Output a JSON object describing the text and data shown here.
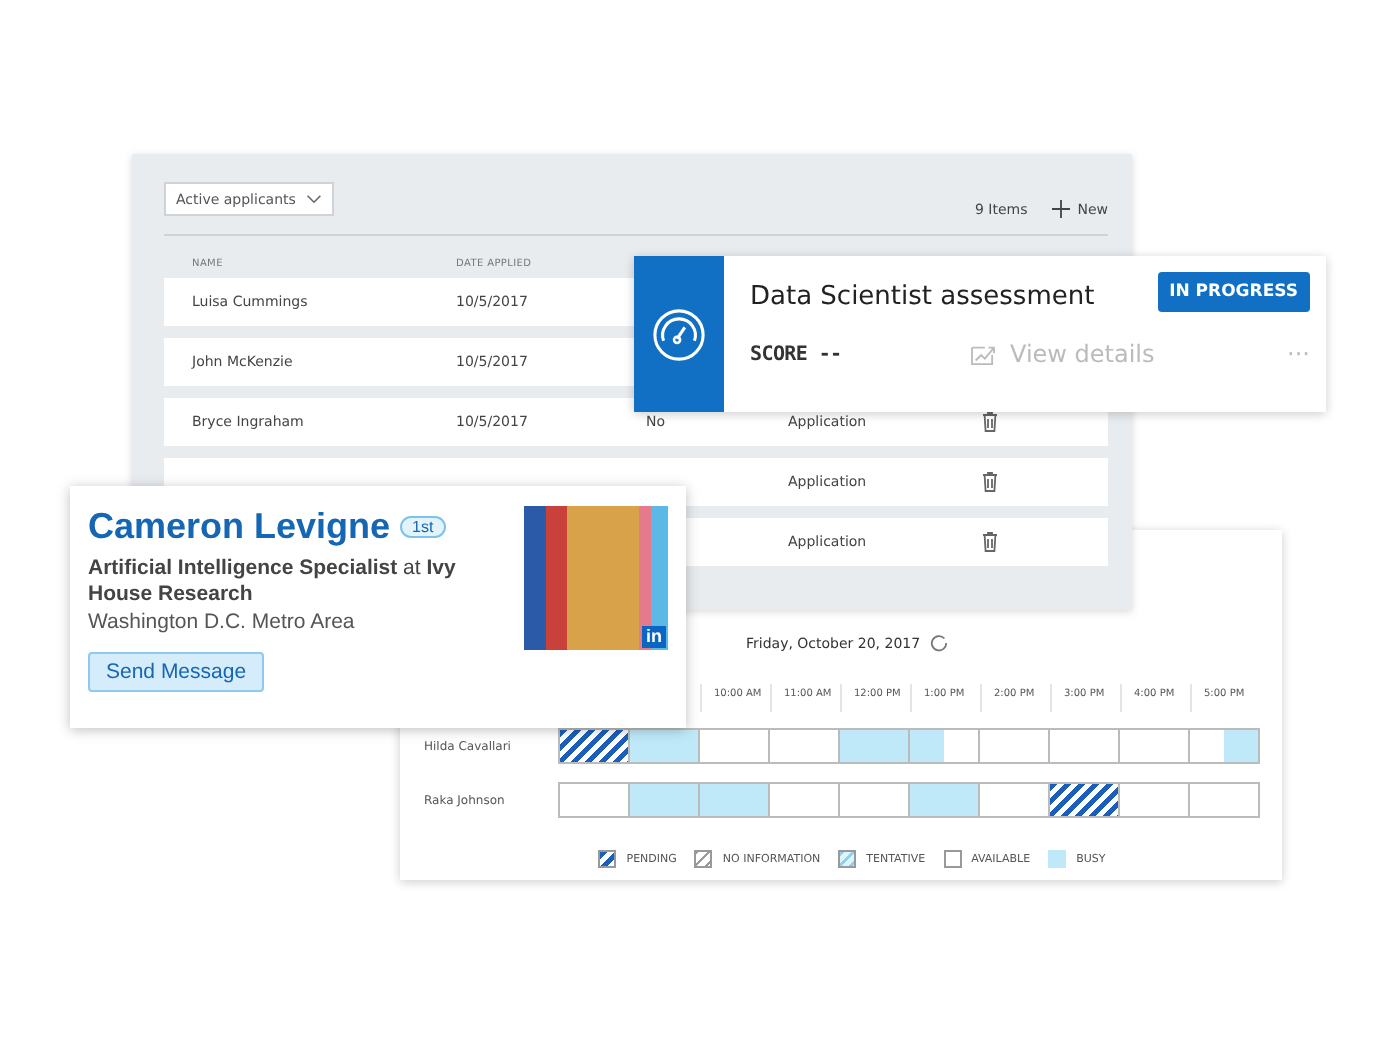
{
  "applicants_panel": {
    "filter": "Active applicants",
    "item_count": "9 Items",
    "new_button": "New",
    "columns": [
      "NAME",
      "DATE APPLIED"
    ],
    "rows": [
      {
        "name": "Luisa Cummings",
        "date": "10/5/2017"
      },
      {
        "name": "John McKenzie",
        "date": "10/5/2017"
      },
      {
        "name": "Bryce Ingraham",
        "date": "10/5/2017",
        "column_3": "No",
        "column_4": "Application"
      },
      {
        "column_4": "Application"
      },
      {
        "column_4": "Application"
      }
    ]
  },
  "schedule": {
    "date": "Friday, October 20, 2017",
    "times": [
      "10:00 AM",
      "11:00 AM",
      "12:00 PM",
      "1:00 PM",
      "2:00 PM",
      "3:00 PM",
      "4:00 PM",
      "5:00 PM"
    ],
    "people": [
      {
        "name": "Hilda Cavallari",
        "hours": [
          {
            "kind": "pending"
          },
          {
            "kind": "busy"
          },
          {
            "kind": "available"
          },
          {
            "kind": "available"
          },
          {
            "kind": "busy"
          },
          {
            "kind": "busy_first_half"
          },
          {
            "kind": "available"
          },
          {
            "kind": "available"
          },
          {
            "kind": "available"
          },
          {
            "kind": "busy_second_half"
          }
        ]
      },
      {
        "name": "Raka Johnson",
        "hours": [
          {
            "kind": "available"
          },
          {
            "kind": "busy"
          },
          {
            "kind": "busy"
          },
          {
            "kind": "available"
          },
          {
            "kind": "available"
          },
          {
            "kind": "busy"
          },
          {
            "kind": "available"
          },
          {
            "kind": "pending"
          },
          {
            "kind": "available"
          },
          {
            "kind": "available"
          }
        ]
      }
    ],
    "legend": [
      {
        "kind": "pending",
        "label": "PENDING"
      },
      {
        "kind": "no_information",
        "label": "NO INFORMATION"
      },
      {
        "kind": "tentative",
        "label": "TENTATIVE"
      },
      {
        "kind": "available",
        "label": "AVAILABLE"
      },
      {
        "kind": "busy",
        "label": "BUSY"
      }
    ]
  },
  "assessment_card": {
    "title": "Data Scientist assessment",
    "status": "IN PROGRESS",
    "score_label": "SCORE",
    "score": "--",
    "link": "View details",
    "more": "···"
  },
  "profile_card": {
    "name": "Cameron Levigne",
    "degree": "1st",
    "headline": "**Artificial Intelligence Specialist** at **Ivy House Research**",
    "location": "Washington D.C. Metro Area",
    "button": "Send Message",
    "photo_badge": "in"
  }
}
